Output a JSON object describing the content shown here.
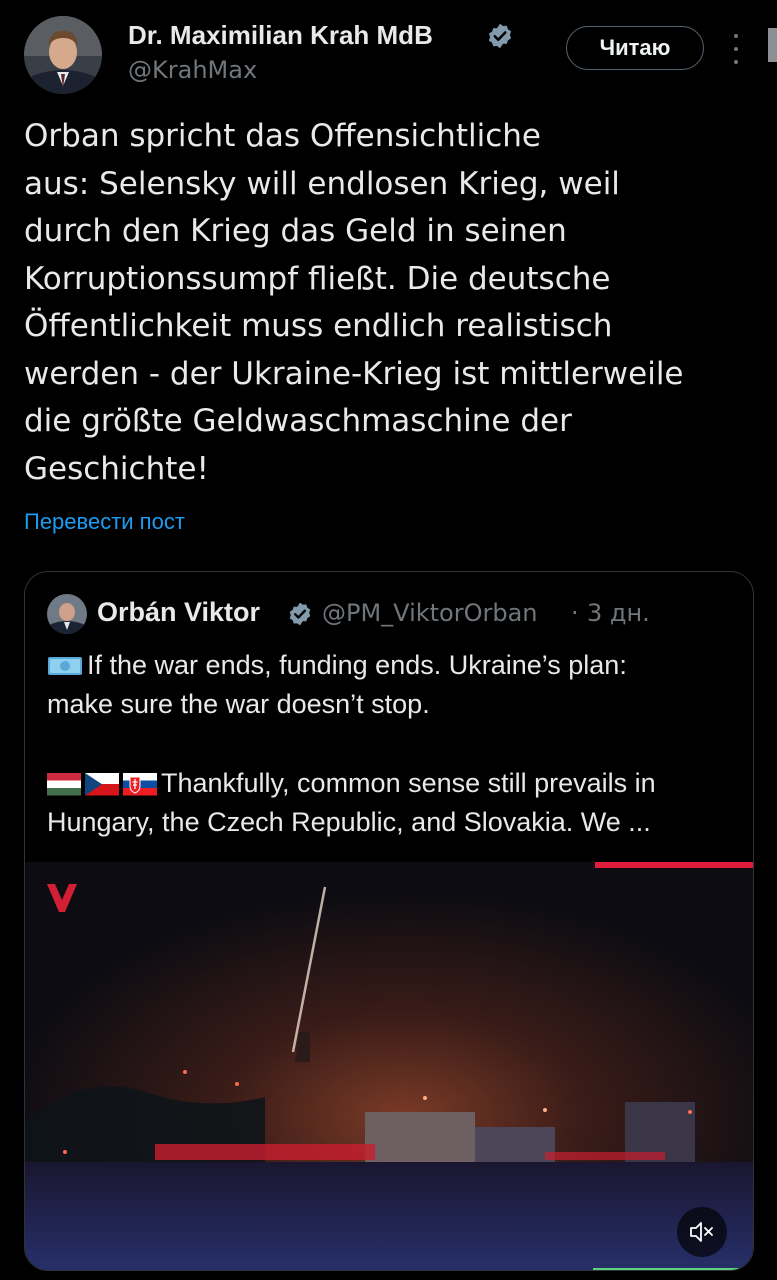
{
  "author": {
    "name": "Dr. Maximilian Krah MdB",
    "handle": "@KrahMax",
    "follow_label": "Читаю",
    "avatar_icon": "user-avatar-photo",
    "verified_icon": "verified-badge-icon"
  },
  "tweet": {
    "lines": [
      "Orban spricht das Offensichtliche",
      "aus: Selensky will endlosen Krieg, weil",
      "durch den Krieg das Geld in seinen",
      "Korruptionssumpf fließt. Die deutsche",
      "Öffentlichkeit muss endlich realistisch",
      "werden - der Ukraine-Krieg ist mittlerweile",
      "die größte Geldwaschmaschine der",
      "Geschichte!"
    ],
    "translate_label": "Перевести пост"
  },
  "quote": {
    "name": "Orbán Viktor",
    "handle": "@PM_ViktorOrban",
    "separator": "·",
    "time": "3 дн.",
    "para1_line1": "If the war ends, funding ends. Ukraine’s plan:",
    "para1_line2": "make sure the war doesn’t stop.",
    "para2_line1": "Thankfully, common sense still prevails in",
    "para2_line2": "Hungary, the Czech Republic, and Slovakia. We ...",
    "emoji1": "money-with-wings-emoji",
    "flags": [
      "flag-hungary",
      "flag-czech-republic",
      "flag-slovakia"
    ]
  },
  "video": {
    "mute_icon": "speaker-muted-icon",
    "logo_icon": "channel-logo-icon"
  },
  "colors": {
    "background": "#000000",
    "text": "#e7e9ea",
    "secondary": "#71767b",
    "link": "#1d9bf0",
    "verified": "#829aab",
    "progress": "#e21c3a"
  }
}
